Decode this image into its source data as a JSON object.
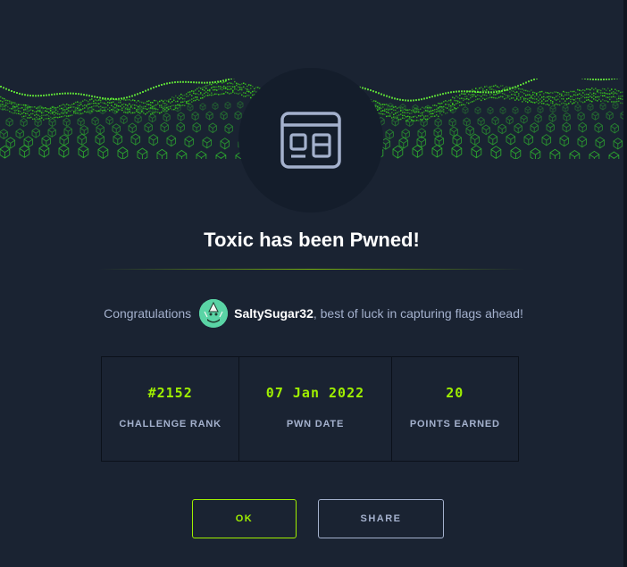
{
  "modal": {
    "title": "Toxic has been Pwned!",
    "congrats_before": "Congratulations",
    "username": "SaltySugar32",
    "congrats_after": ", best of luck in capturing flags ahead!",
    "icon": "web-challenge-icon",
    "accent_color": "#9fef00"
  },
  "stats": [
    {
      "value": "#2152",
      "label": "CHALLENGE RANK"
    },
    {
      "value": "07 Jan 2022",
      "label": "PWN DATE"
    },
    {
      "value": "20",
      "label": "POINTS EARNED"
    }
  ],
  "buttons": {
    "ok": "OK",
    "share": "SHARE"
  }
}
